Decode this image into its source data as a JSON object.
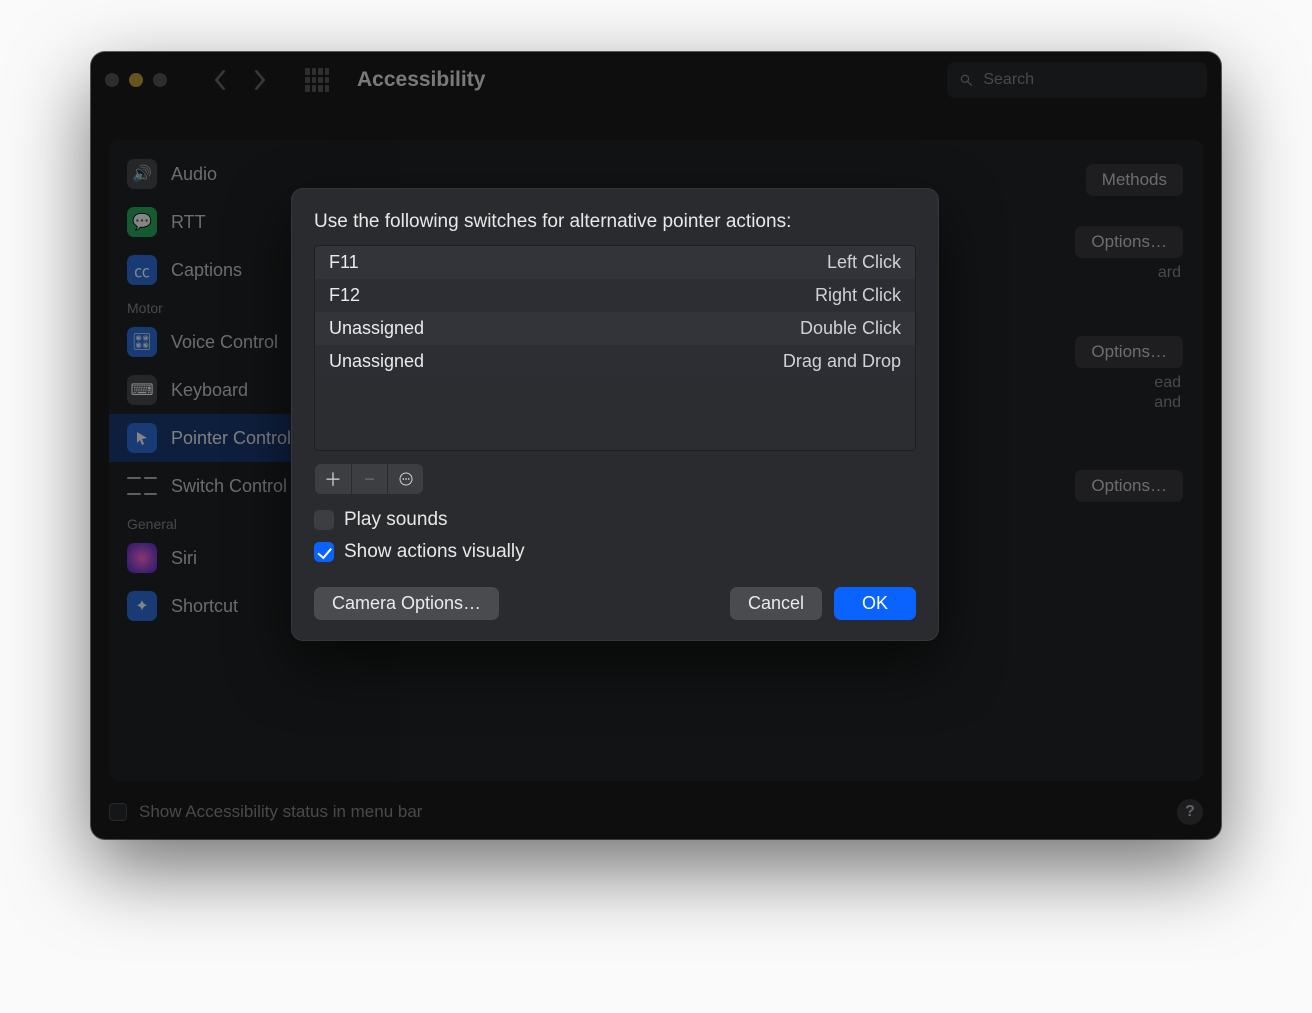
{
  "toolbar": {
    "title": "Accessibility",
    "search_placeholder": "Search"
  },
  "sidebar": {
    "items": [
      {
        "label": "Audio"
      },
      {
        "label": "RTT"
      },
      {
        "label": "Captions"
      }
    ],
    "motor_label": "Motor",
    "motor_items": [
      {
        "label": "Voice Control"
      },
      {
        "label": "Keyboard"
      },
      {
        "label": "Pointer Control"
      },
      {
        "label": "Switch Control"
      }
    ],
    "general_label": "General",
    "general_items": [
      {
        "label": "Siri"
      },
      {
        "label": "Shortcut"
      }
    ]
  },
  "right": {
    "methods_btn": "Methods",
    "options_btn": "Options…",
    "keyboard_text": "ard",
    "instead_text1": "ead",
    "instead_text2": "and"
  },
  "footer": {
    "label": "Show Accessibility status in menu bar"
  },
  "sheet": {
    "title": "Use the following switches for alternative pointer actions:",
    "rows": [
      {
        "key": "F11",
        "action": "Left Click"
      },
      {
        "key": "F12",
        "action": "Right Click"
      },
      {
        "key": "Unassigned",
        "action": "Double Click"
      },
      {
        "key": "Unassigned",
        "action": "Drag and Drop"
      }
    ],
    "play_sounds_label": "Play sounds",
    "show_visually_label": "Show actions visually",
    "camera_btn": "Camera Options…",
    "cancel_btn": "Cancel",
    "ok_btn": "OK"
  }
}
